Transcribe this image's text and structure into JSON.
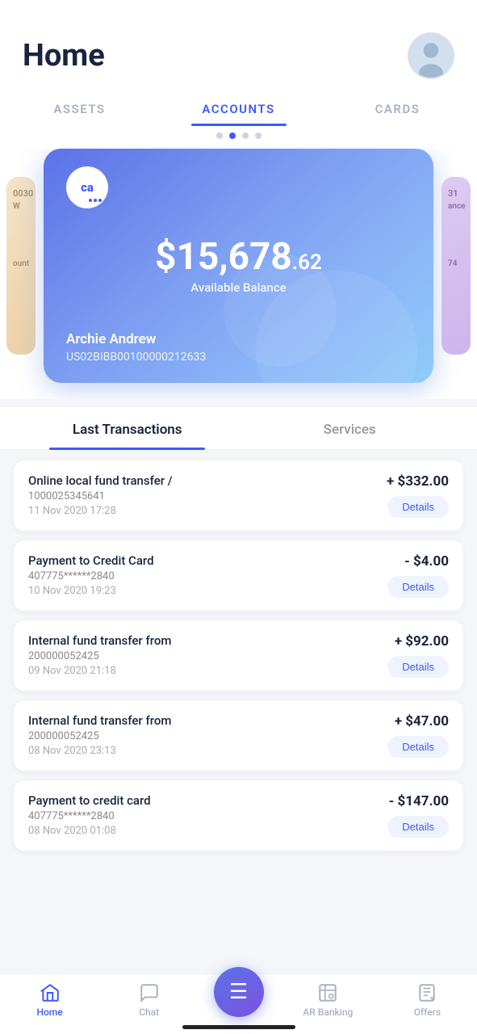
{
  "header": {
    "title": "Home"
  },
  "nav": {
    "tabs": [
      {
        "id": "assets",
        "label": "ASSETS",
        "active": false
      },
      {
        "id": "accounts",
        "label": "ACCOUNTS",
        "active": true
      },
      {
        "id": "cards",
        "label": "CARDS",
        "active": false
      }
    ],
    "dots": [
      false,
      true,
      false,
      false
    ]
  },
  "card": {
    "logo_text": "ca",
    "balance_main": "$15,678",
    "balance_cents": ".62",
    "balance_label": "Available Balance",
    "owner_name": "Archie Andrew",
    "account_number": "US02BIBB00100000212633"
  },
  "section_tabs": {
    "tab1": "Last Transactions",
    "tab2": "Services"
  },
  "transactions": [
    {
      "title": "Online local fund transfer /",
      "subtitle": "1000025345641",
      "date": "11 Nov 2020 17:28",
      "amount": "+ $332.00",
      "type": "positive",
      "btn": "Details"
    },
    {
      "title": "Payment to Credit Card",
      "subtitle": "407775******2840",
      "date": "10 Nov 2020 19:23",
      "amount": "- $4.00",
      "type": "negative",
      "btn": "Details"
    },
    {
      "title": "Internal fund transfer from",
      "subtitle": "200000052425",
      "date": "09 Nov 2020 21:18",
      "amount": "+ $92.00",
      "type": "positive",
      "btn": "Details"
    },
    {
      "title": "Internal fund transfer from",
      "subtitle": "200000052425",
      "date": "08 Nov 2020 23:13",
      "amount": "+ $47.00",
      "type": "positive",
      "btn": "Details"
    },
    {
      "title": "Payment to credit card",
      "subtitle": "407775******2840",
      "date": "08 Nov 2020 01:08",
      "amount": "- $147.00",
      "type": "negative",
      "btn": "Details"
    }
  ],
  "bottom_nav": {
    "items": [
      {
        "id": "home",
        "label": "Home",
        "active": true
      },
      {
        "id": "chat",
        "label": "Chat",
        "active": false
      },
      {
        "id": "fab",
        "label": "",
        "active": false
      },
      {
        "id": "ar_banking",
        "label": "AR Banking",
        "active": false
      },
      {
        "id": "offers",
        "label": "Offers",
        "active": false
      }
    ]
  },
  "colors": {
    "accent": "#3d5afe",
    "positive": "#1a2340",
    "negative": "#1a2340"
  }
}
